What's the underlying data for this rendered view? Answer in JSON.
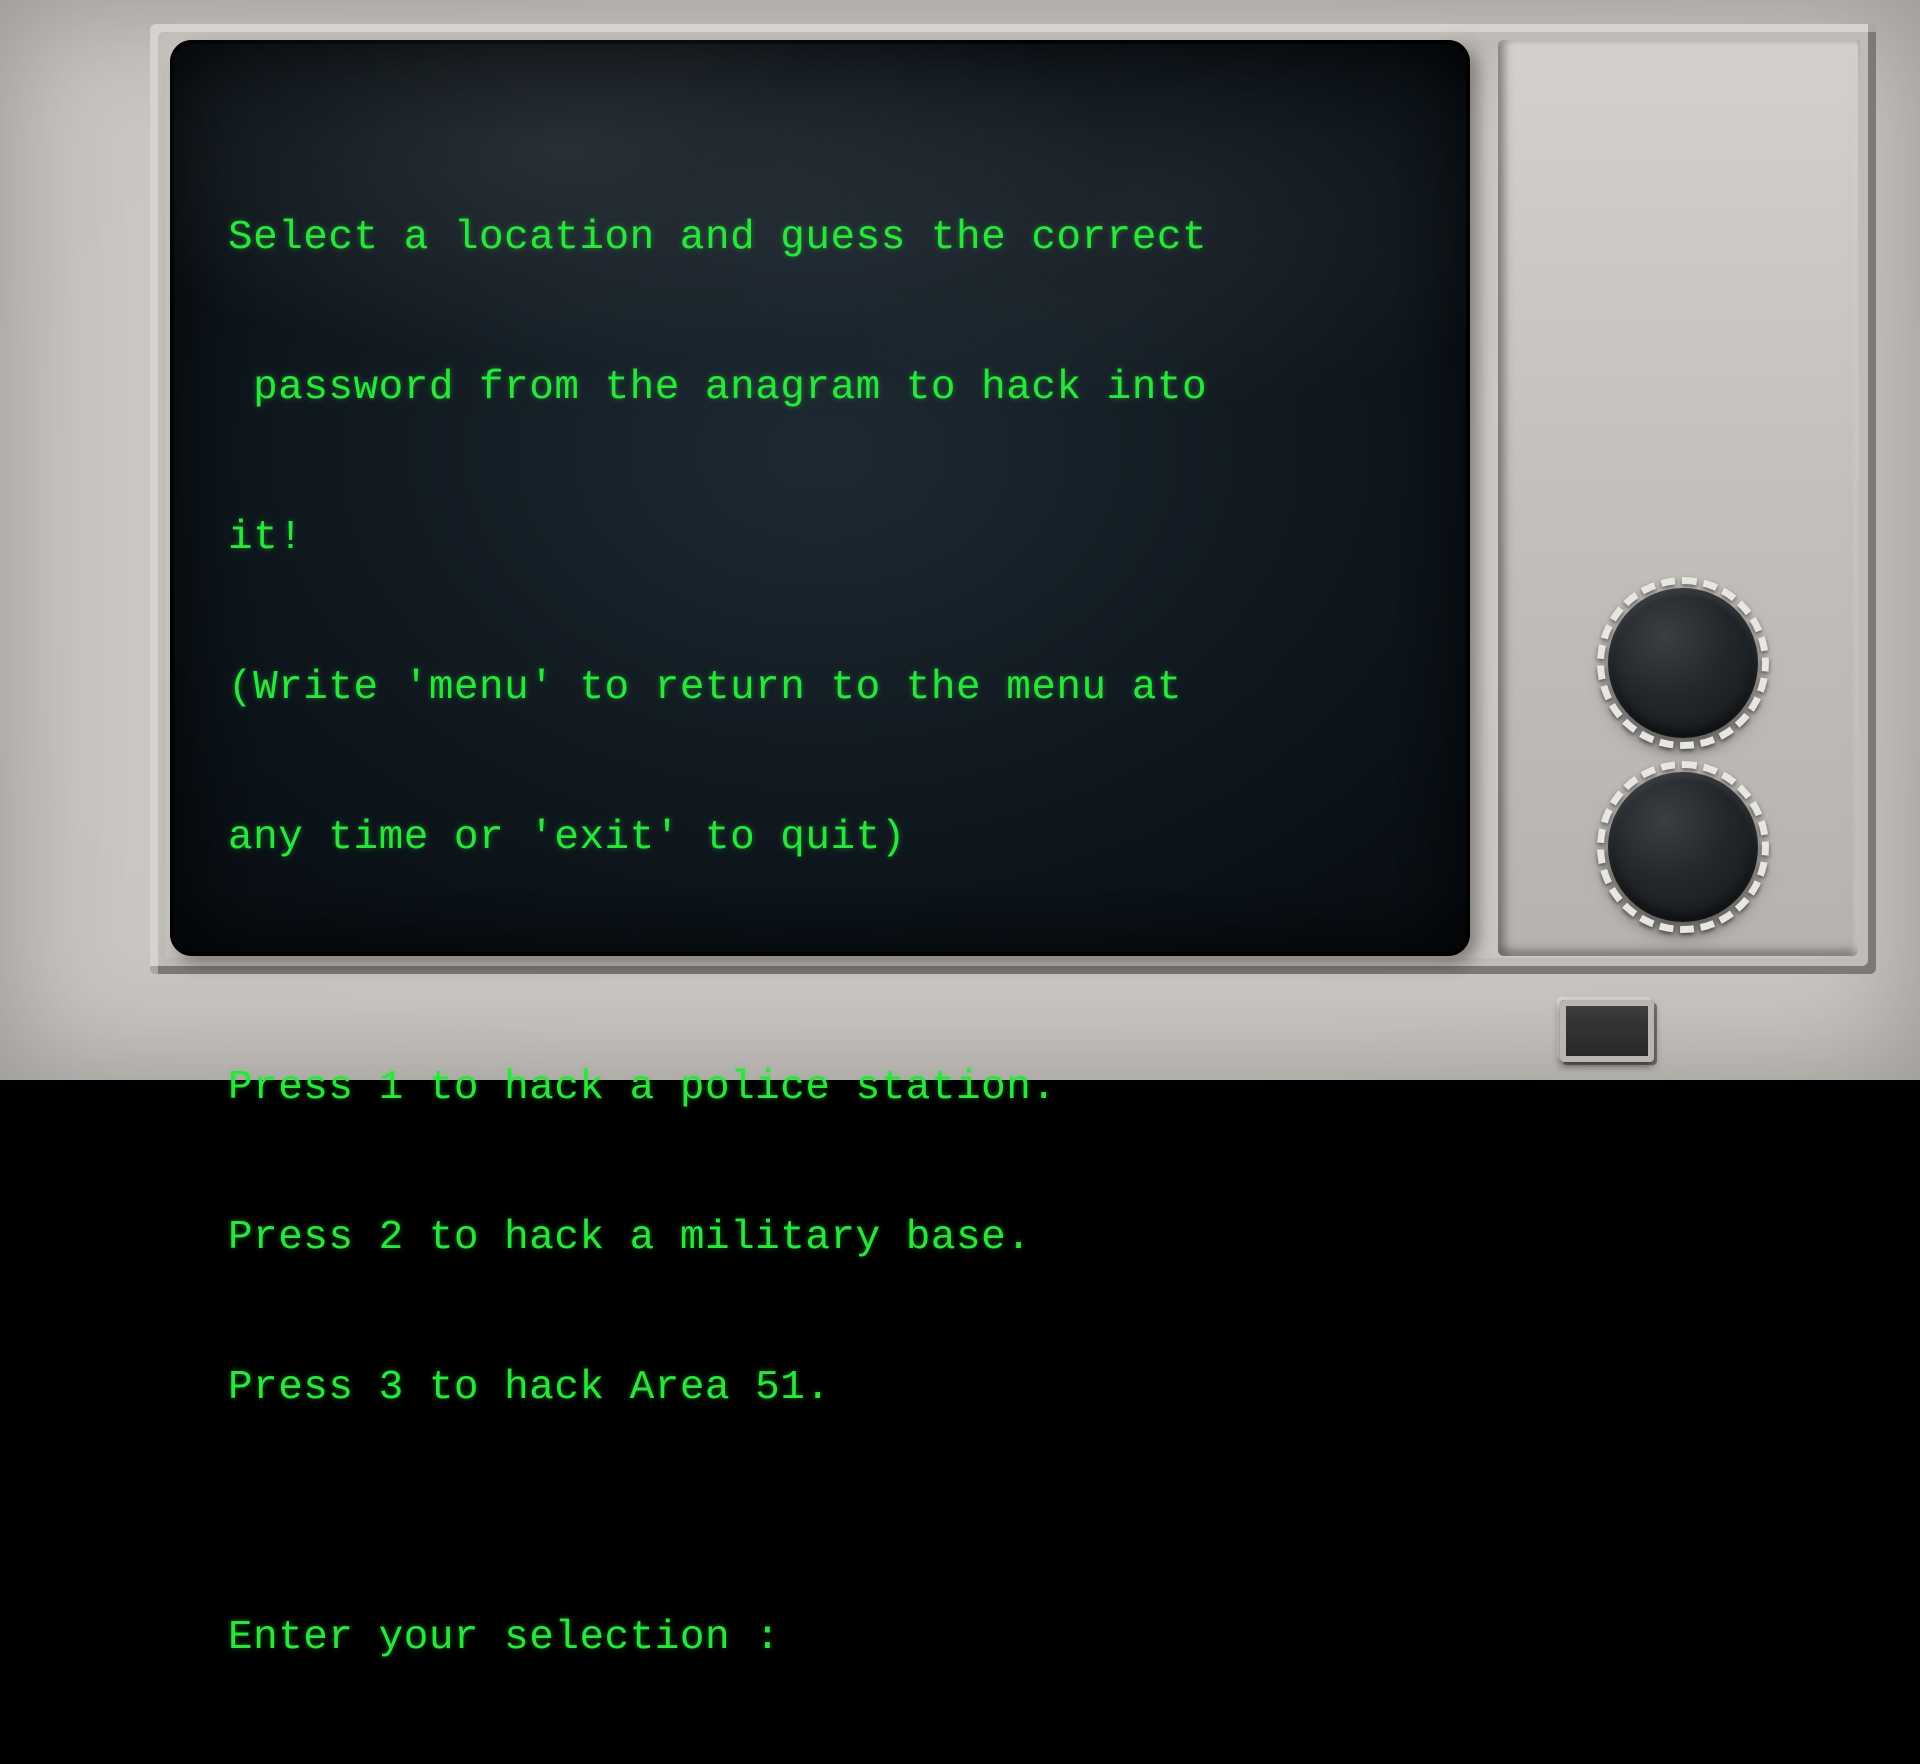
{
  "terminal": {
    "intro_line1": "Select a location and guess the correct",
    "intro_line2": " password from the anagram to hack into",
    "intro_line3": "it!",
    "hint_line1": "(Write 'menu' to return to the menu at",
    "hint_line2": "any time or 'exit' to quit)",
    "blank": "",
    "option1": "Press 1 to hack a police station.",
    "option2": "Press 2 to hack a military base.",
    "option3": "Press 3 to hack Area 51.",
    "prompt": "Enter your selection :"
  },
  "colors": {
    "text": "#29e63c",
    "screen_dark": "#0b1218",
    "casing": "#c7c3bf"
  }
}
